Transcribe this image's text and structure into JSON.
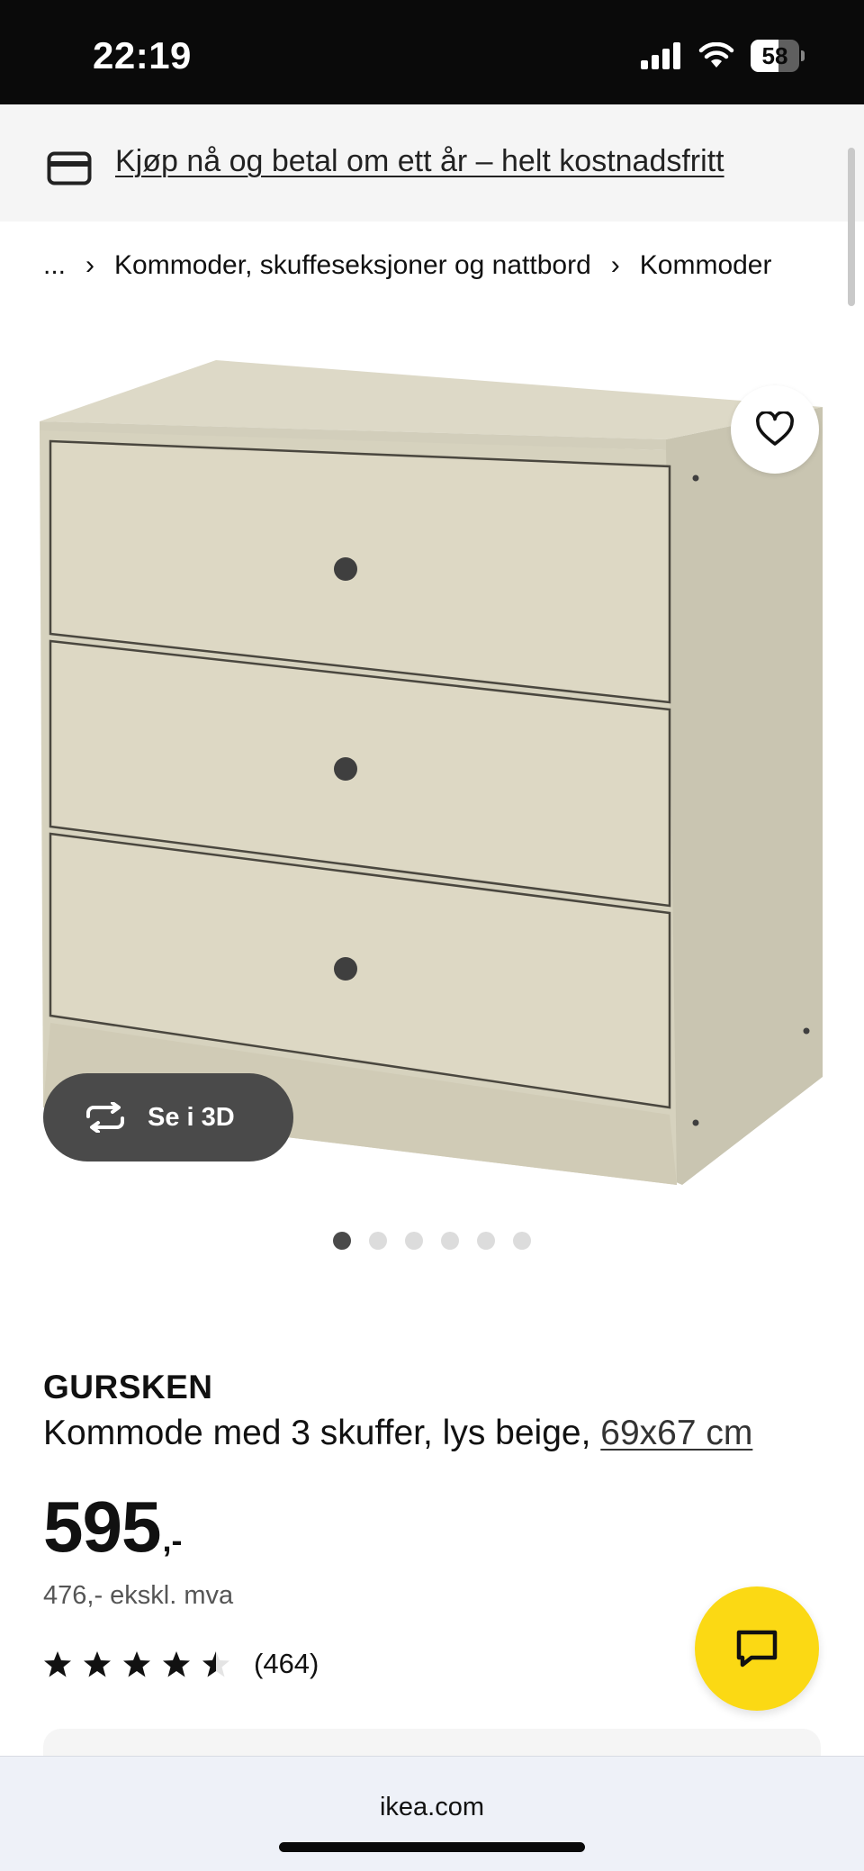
{
  "status_bar": {
    "time": "22:19",
    "battery": "58"
  },
  "promo": {
    "text": "Kjøp nå og betal om ett år – helt kostnadsfritt"
  },
  "breadcrumb": {
    "ellipsis": "...",
    "items": [
      "Kommoder, skuffeseksjoner og nattbord",
      "Kommoder"
    ]
  },
  "product": {
    "view_3d_label": "Se i 3D",
    "image_count": 6,
    "active_image": 1,
    "brand": "GURSKEN",
    "description": "Kommode med 3 skuffer, lys beige, ",
    "size": "69x67 cm",
    "price": "595",
    "price_suffix": ",-",
    "price_ex_vat": "476,- ekskl. mva",
    "rating_value": 4.5,
    "rating_count": "(464)"
  },
  "browser": {
    "url": "ikea.com"
  },
  "colors": {
    "chat_button": "#fbd914",
    "promo_bg": "#f5f5f5",
    "view3d_bg": "#4a4a4a"
  }
}
